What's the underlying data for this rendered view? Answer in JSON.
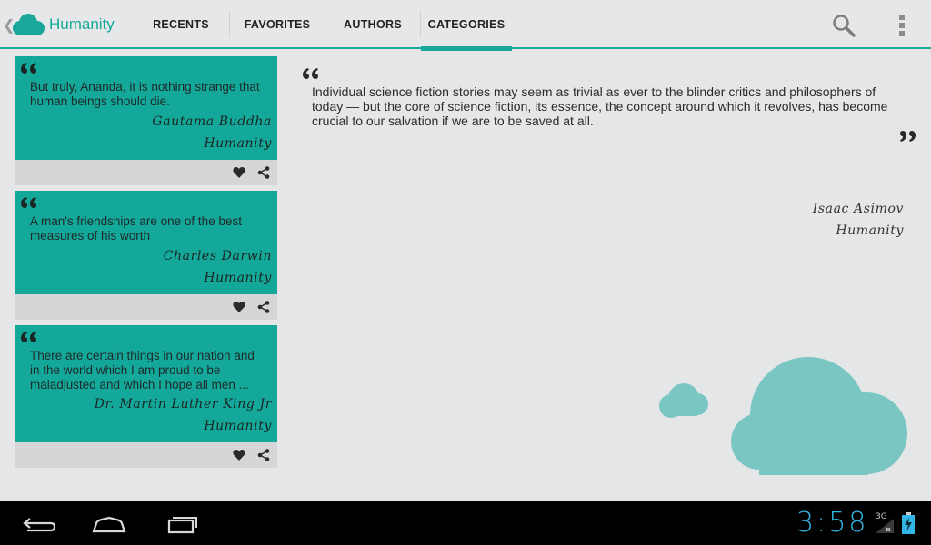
{
  "app": {
    "title": "Humanity"
  },
  "tabs": [
    {
      "label": "RECENTS"
    },
    {
      "label": "FAVORITES"
    },
    {
      "label": "AUTHORS"
    },
    {
      "label": "CATEGORIES",
      "active": true
    }
  ],
  "icons": {
    "search": "search-icon",
    "overflow": "overflow-menu-icon",
    "favorite": "heart-icon",
    "share": "share-icon",
    "quote": "quote-mark-icon"
  },
  "quotes": [
    {
      "text": "But truly, Ananda, it is nothing strange that human beings should die.",
      "author": "Gautama Buddha",
      "category": "Humanity"
    },
    {
      "text": "A man's friendships are one of the best measures of his worth",
      "author": "Charles Darwin",
      "category": "Humanity"
    },
    {
      "text": "There are certain things in our nation and in the world which I am proud to be maladjusted and which I hope all men ...",
      "author": "Dr. Martin Luther King Jr",
      "category": "Humanity"
    }
  ],
  "detail": {
    "text": "Individual science fiction stories may seem as trivial as ever to the blinder critics and philosophers of today — but the core of science fiction, its essence, the concept around which it revolves, has become crucial to our salvation if we are to be saved at all.",
    "author": "Isaac Asimov",
    "category": "Humanity"
  },
  "status": {
    "time": "3:58",
    "network": "3G"
  },
  "colors": {
    "accent": "#1aa79a",
    "card": "#14a89a",
    "cloud": "#79c6c3",
    "clock": "#33b5e5"
  }
}
